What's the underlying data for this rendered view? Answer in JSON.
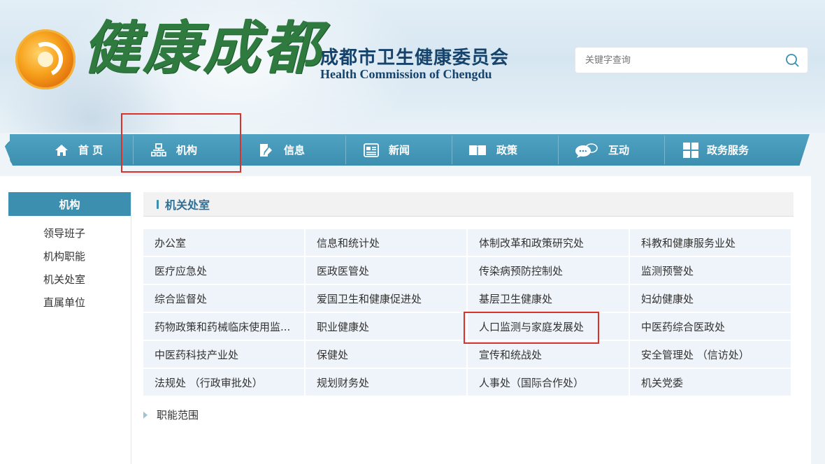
{
  "header": {
    "logo_text": "健康成都",
    "org_name_cn": "成都市卫生健康委员会",
    "org_name_en": "Health Commission of Chengdu",
    "search_placeholder": "关键字查询",
    "search_icon": "search-icon"
  },
  "nav": {
    "items": [
      {
        "label": "首 页",
        "icon": "home-icon"
      },
      {
        "label": "机构",
        "icon": "org-chart-icon"
      },
      {
        "label": "信息",
        "icon": "edit-doc-icon"
      },
      {
        "label": "新闻",
        "icon": "newspaper-icon"
      },
      {
        "label": "政策",
        "icon": "book-icon"
      },
      {
        "label": "互动",
        "icon": "chat-icon"
      },
      {
        "label": "政务服务",
        "icon": "grid-icon"
      }
    ]
  },
  "sidebar": {
    "title": "机构",
    "items": [
      {
        "label": "领导班子"
      },
      {
        "label": "机构职能"
      },
      {
        "label": "机关处室"
      },
      {
        "label": "直属单位"
      }
    ]
  },
  "main": {
    "section_title": "机关处室",
    "departments": [
      [
        "办公室",
        "信息和统计处",
        "体制改革和政策研究处",
        "科教和健康服务业处"
      ],
      [
        "医疗应急处",
        "医政医管处",
        "传染病预防控制处",
        "监测预警处"
      ],
      [
        "综合监督处",
        "爱国卫生和健康促进处",
        "基层卫生健康处",
        "妇幼健康处"
      ],
      [
        "药物政策和药械临床使用监...",
        "职业健康处",
        "人口监测与家庭发展处",
        "中医药综合医政处"
      ],
      [
        "中医药科技产业处",
        "保健处",
        "宣传和统战处",
        "安全管理处 （信访处）"
      ],
      [
        "法规处 （行政审批处）",
        "规划财务处",
        "人事处（国际合作处）",
        "机关党委"
      ]
    ],
    "more_link": "职能范围"
  },
  "colors": {
    "nav_blue": "#3d8fb0",
    "highlight_red": "#d8322a",
    "logo_green": "#2f7a3f",
    "org_text": "#16436b"
  }
}
